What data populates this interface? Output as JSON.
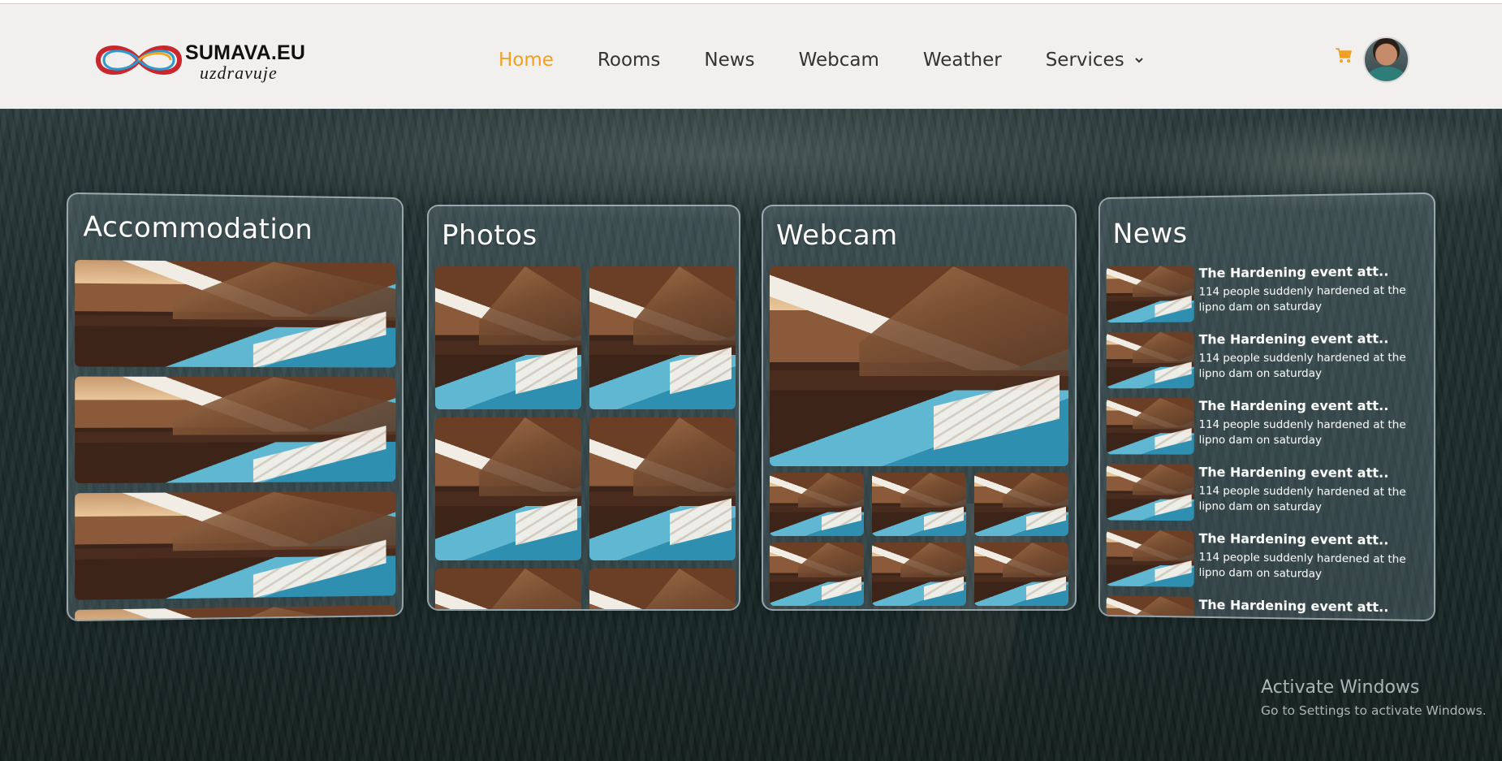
{
  "header": {
    "logo_title": "SUMAVA.EU",
    "logo_subtitle": "uzdravuje",
    "nav": [
      {
        "label": "Home",
        "active": true
      },
      {
        "label": "Rooms",
        "active": false
      },
      {
        "label": "News",
        "active": false
      },
      {
        "label": "Webcam",
        "active": false
      },
      {
        "label": "Weather",
        "active": false
      },
      {
        "label": "Services",
        "active": false,
        "has_dropdown": true
      }
    ],
    "cart_icon": "cart-icon",
    "avatar_icon": "user-avatar",
    "accent_color": "#f0a023"
  },
  "cards": {
    "accommodation_title": "Accommodation",
    "photos_title": "Photos",
    "webcam_title": "Webcam",
    "news_title": "News"
  },
  "news_items": [
    {
      "title": "The Hardening event att..",
      "description": "114 people suddenly hardened at the lipno dam on saturday"
    },
    {
      "title": "The Hardening event att..",
      "description": "114 people suddenly hardened at the lipno dam on saturday"
    },
    {
      "title": "The Hardening event att..",
      "description": "114 people suddenly hardened at the lipno dam on saturday"
    },
    {
      "title": "The Hardening event att..",
      "description": "114 people suddenly hardened at the lipno dam on saturday"
    },
    {
      "title": "The Hardening event att..",
      "description": "114 people suddenly hardened at the lipno dam on saturday"
    },
    {
      "title": "The Hardening event att..",
      "description": ""
    }
  ],
  "watermark": {
    "title": "Activate Windows",
    "subtitle": "Go to Settings to activate Windows."
  }
}
